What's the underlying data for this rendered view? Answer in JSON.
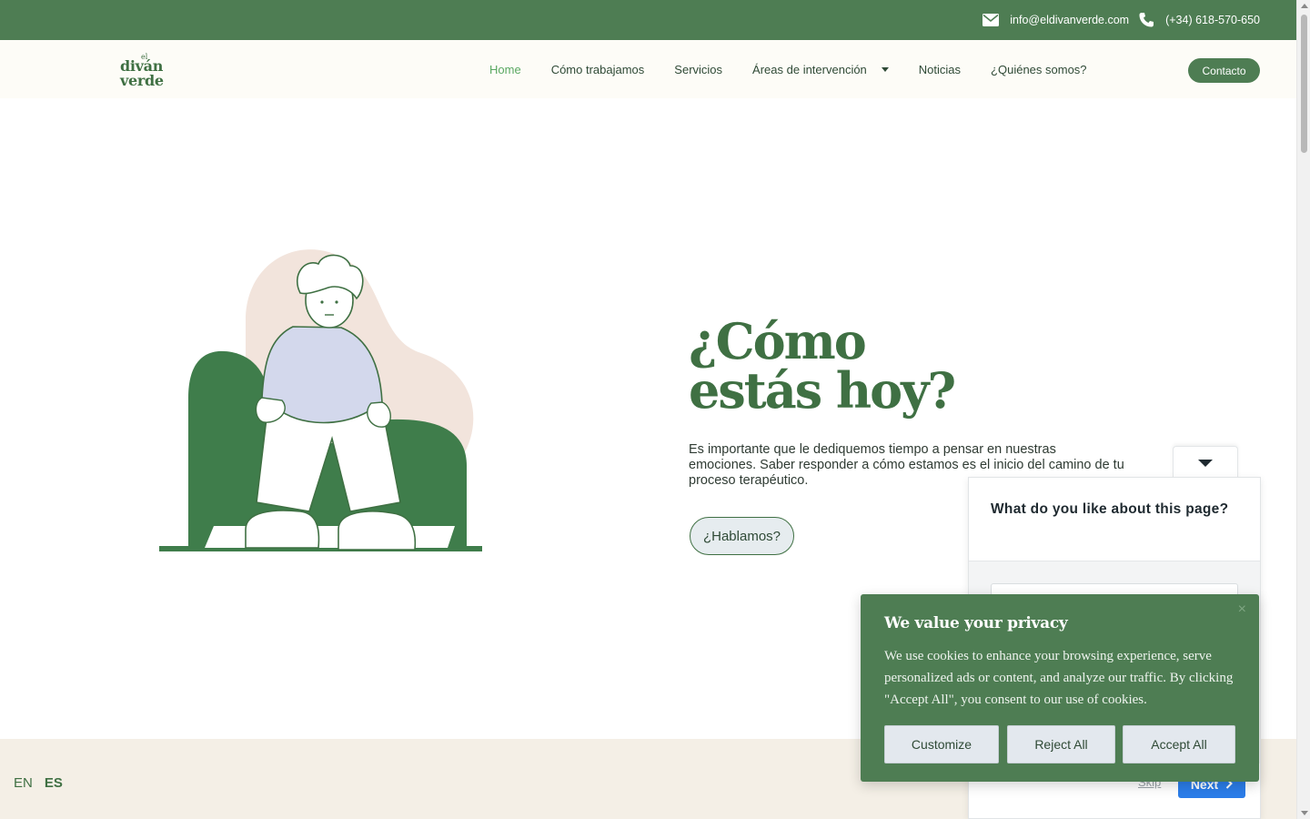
{
  "topbar": {
    "email": "info@eldivanverde.com",
    "phone": "(+34) 618-570-650"
  },
  "logo": {
    "line0": "el",
    "line1": "diván",
    "line2": "verde"
  },
  "nav": {
    "items": [
      {
        "label": "Home",
        "active": true
      },
      {
        "label": "Cómo trabajamos"
      },
      {
        "label": "Servicios"
      },
      {
        "label": "Áreas de intervención",
        "dropdown": true
      },
      {
        "label": "Noticias"
      },
      {
        "label": "¿Quiénes somos?"
      }
    ],
    "contact_button": "Contacto"
  },
  "hero": {
    "title_line1": "¿Cómo",
    "title_line2": "estás hoy?",
    "text": "Es importante que le dediquemos tiempo a pensar en nuestras emociones. Saber responder a cómo estamos es el inicio del camino de tu proceso terapéutico.",
    "cta": "¿Hablamos?"
  },
  "language": {
    "options": [
      "EN",
      "ES"
    ],
    "current": "ES"
  },
  "feedback": {
    "question": "What do you like about this page?",
    "skip": "Skip",
    "next": "Next"
  },
  "cookie": {
    "title": "We value your privacy",
    "text": "We use cookies to enhance your browsing experience, serve personalized ads or content, and analyze our traffic. By clicking \"Accept All\", you consent to our use of cookies.",
    "customize": "Customize",
    "reject": "Reject All",
    "accept": "Accept All",
    "close": "×"
  },
  "colors": {
    "brand_green": "#4e7d53",
    "accent_green": "#5aa862",
    "footer_beige": "#f4efe6",
    "next_blue": "#2b7de9"
  }
}
